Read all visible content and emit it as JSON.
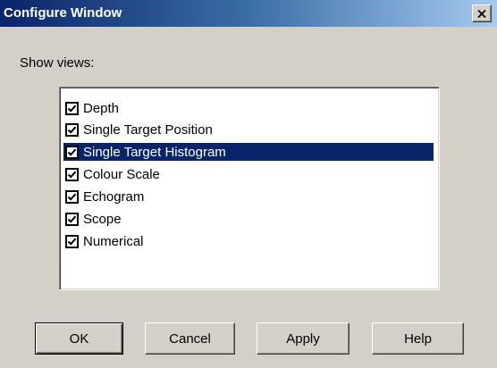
{
  "window": {
    "title": "Configure Window"
  },
  "titlebar": {
    "close_icon": "close-icon",
    "gradient_start": "#0a246a",
    "gradient_end": "#a6caf0"
  },
  "show_views": {
    "label": "Show views:",
    "items": [
      {
        "label": "Depth",
        "checked": true,
        "selected": false
      },
      {
        "label": "Single Target Position",
        "checked": true,
        "selected": false
      },
      {
        "label": "Single Target Histogram",
        "checked": true,
        "selected": true
      },
      {
        "label": "Colour Scale",
        "checked": true,
        "selected": false
      },
      {
        "label": "Echogram",
        "checked": true,
        "selected": false
      },
      {
        "label": "Scope",
        "checked": true,
        "selected": false
      },
      {
        "label": "Numerical",
        "checked": true,
        "selected": false
      }
    ]
  },
  "buttons": {
    "ok": "OK",
    "cancel": "Cancel",
    "apply": "Apply",
    "help": "Help"
  },
  "colors": {
    "dialog_background": "#d4d0c8",
    "selection_background": "#0a246a",
    "selection_text": "#ffffff"
  }
}
